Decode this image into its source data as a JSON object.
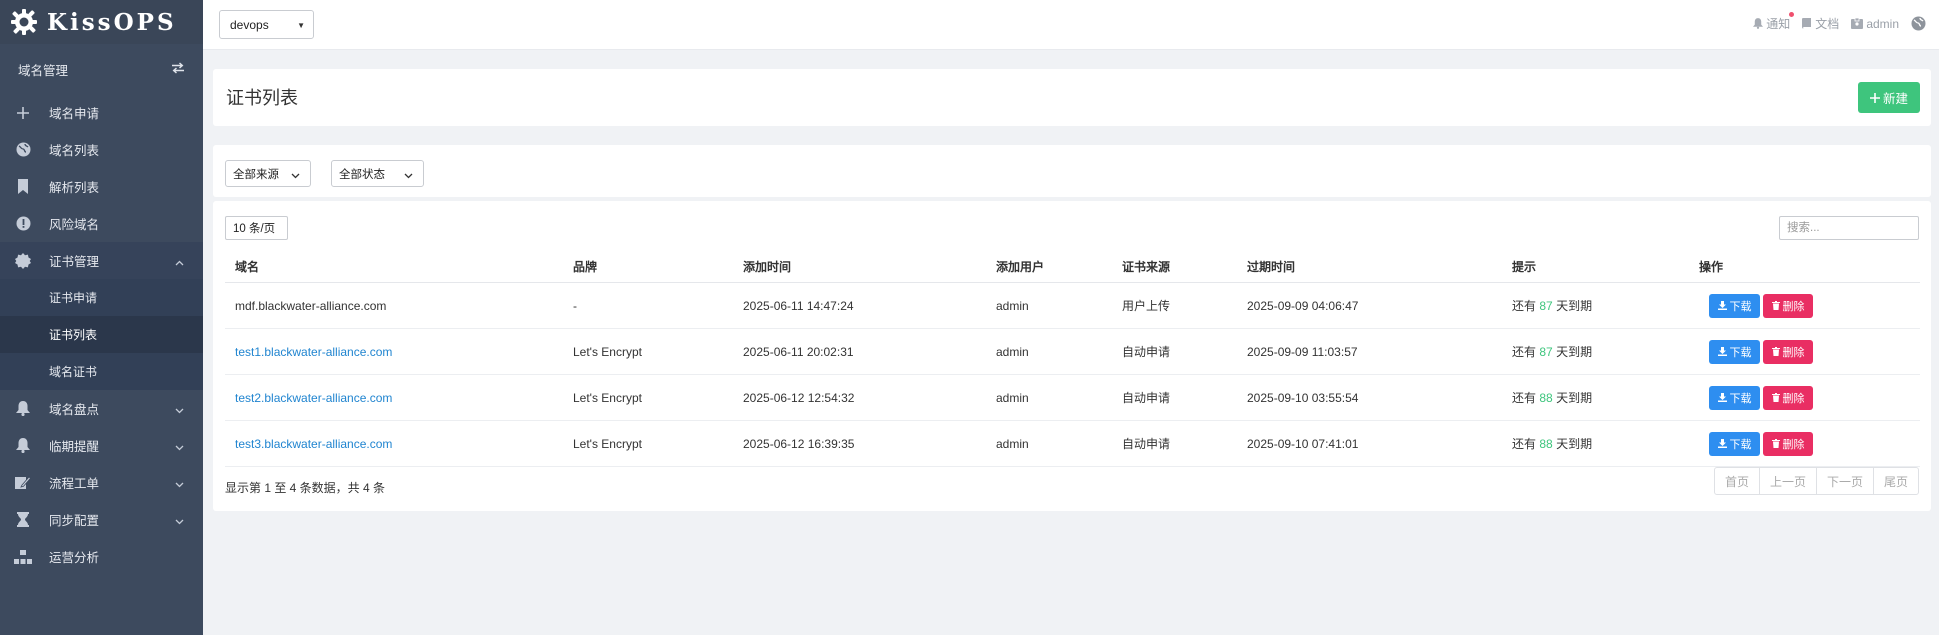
{
  "brand": {
    "name": "KissOPS"
  },
  "sidebar": {
    "section_title": "域名管理",
    "menu": [
      {
        "label": "域名申请",
        "icon": "plus-icon"
      },
      {
        "label": "域名列表",
        "icon": "globe-icon"
      },
      {
        "label": "解析列表",
        "icon": "bookmark-icon"
      },
      {
        "label": "风险域名",
        "icon": "alert-circle-icon"
      },
      {
        "label": "证书管理",
        "icon": "certificate-icon"
      }
    ],
    "submenu": [
      {
        "label": "证书申请"
      },
      {
        "label": "证书列表"
      },
      {
        "label": "域名证书"
      }
    ],
    "menu2": [
      {
        "label": "域名盘点",
        "icon": "bell-icon"
      },
      {
        "label": "临期提醒",
        "icon": "bell-icon"
      },
      {
        "label": "流程工单",
        "icon": "workflow-icon"
      },
      {
        "label": "同步配置",
        "icon": "hourglass-icon"
      },
      {
        "label": "运营分析",
        "icon": "sitemap-icon"
      }
    ]
  },
  "topbar": {
    "org": "devops",
    "notify": "通知",
    "docs": "文档",
    "user": "admin"
  },
  "page": {
    "title": "证书列表",
    "new_button": "新建"
  },
  "filters": {
    "source": "全部来源",
    "status": "全部状态"
  },
  "table": {
    "per_page": "10 条/页",
    "search_placeholder": "搜索...",
    "headers": [
      "域名",
      "品牌",
      "添加时间",
      "添加用户",
      "证书来源",
      "过期时间",
      "提示",
      "操作"
    ],
    "rows": [
      {
        "domain": "mdf.blackwater-alliance.com",
        "brand": "-",
        "added": "2025-06-11 14:47:24",
        "user": "admin",
        "source": "用户上传",
        "expires": "2025-09-09 04:06:47",
        "hint_pre": "还有",
        "days": "87",
        "hint_post": "天到期",
        "link": false
      },
      {
        "domain": "test1.blackwater-alliance.com",
        "brand": "Let's Encrypt",
        "added": "2025-06-11 20:02:31",
        "user": "admin",
        "source": "自动申请",
        "expires": "2025-09-09 11:03:57",
        "hint_pre": "还有",
        "days": "87",
        "hint_post": "天到期",
        "link": true
      },
      {
        "domain": "test2.blackwater-alliance.com",
        "brand": "Let's Encrypt",
        "added": "2025-06-12 12:54:32",
        "user": "admin",
        "source": "自动申请",
        "expires": "2025-09-10 03:55:54",
        "hint_pre": "还有",
        "days": "88",
        "hint_post": "天到期",
        "link": true
      },
      {
        "domain": "test3.blackwater-alliance.com",
        "brand": "Let's Encrypt",
        "added": "2025-06-12 16:39:35",
        "user": "admin",
        "source": "自动申请",
        "expires": "2025-09-10 07:41:01",
        "hint_pre": "还有",
        "days": "88",
        "hint_post": "天到期",
        "link": true
      }
    ],
    "download_label": "下载",
    "delete_label": "删除",
    "footer": "显示第 1 至 4 条数据，共 4 条",
    "pager": [
      "首页",
      "上一页",
      "下一页",
      "尾页"
    ]
  },
  "colors": {
    "sidebar": "#3d4a5e",
    "accent_green": "#3ec57d",
    "download_blue": "#2e8ef0",
    "delete_red": "#e92e63",
    "link_blue": "#2185d0"
  }
}
